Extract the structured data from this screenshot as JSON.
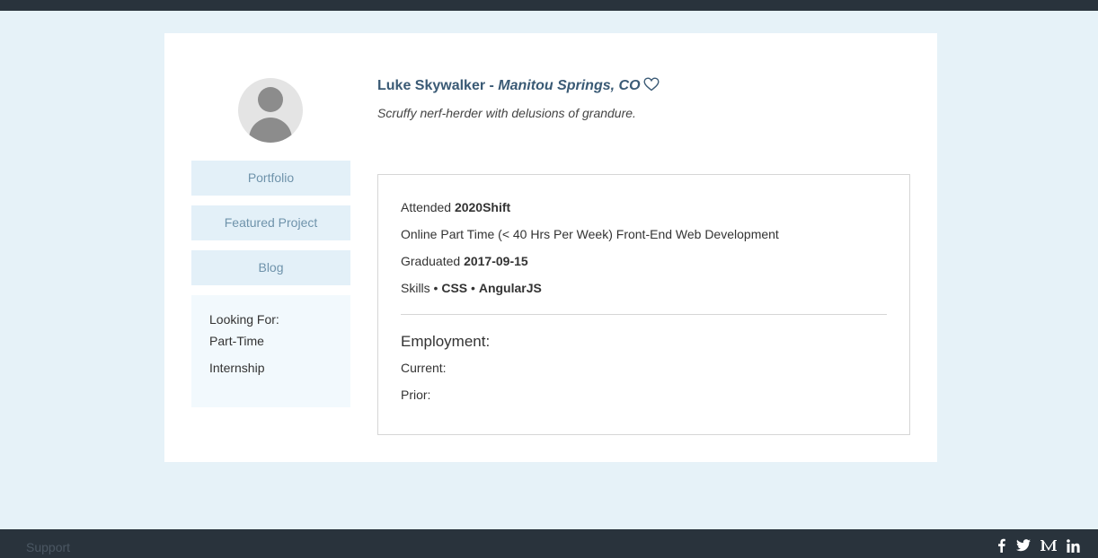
{
  "profile": {
    "name": "Luke Skywalker",
    "separator": " - ",
    "location": "Manitou Springs, CO",
    "tagline": "Scruffy nerf-herder with delusions of grandure."
  },
  "nav": {
    "portfolio": "Portfolio",
    "featured": "Featured Project",
    "blog": "Blog"
  },
  "looking_for": {
    "title": "Looking For:",
    "items": [
      "Part-Time",
      "Internship"
    ]
  },
  "education": {
    "attended_label": "Attended ",
    "school": "2020Shift",
    "program": "Online Part Time (< 40 Hrs Per Week) Front-End Web Development",
    "graduated_label": "Graduated ",
    "graduated_date": "2017-09-15",
    "skills_label": "Skills",
    "skills": [
      "CSS",
      "AngularJS"
    ],
    "bullet": " • "
  },
  "employment": {
    "title": "Employment:",
    "current_label": "Current:",
    "prior_label": "Prior:"
  },
  "footer": {
    "support": "Support",
    "social_icons": [
      "facebook-icon",
      "twitter-icon",
      "medium-icon",
      "linkedin-icon"
    ]
  },
  "colors": {
    "page_bg": "#e6f2f8",
    "bar_bg": "#29333c",
    "name": "#3a5a75",
    "nav_bg": "#e3f0f8",
    "nav_text": "#6f93ab"
  }
}
